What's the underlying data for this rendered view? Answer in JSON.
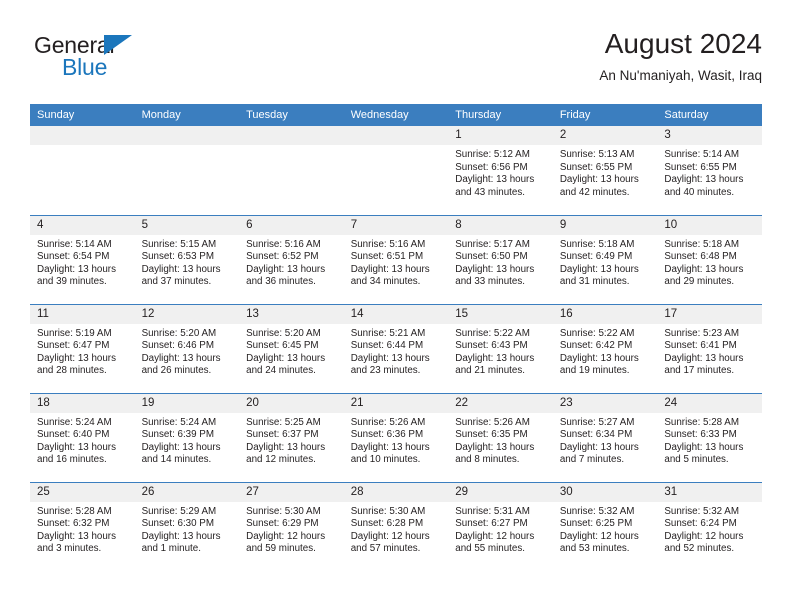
{
  "logo": {
    "word_top": "General",
    "word_bottom": "Blue",
    "accent_color": "#1b76bc"
  },
  "header": {
    "title": "August 2024",
    "subtitle": "An Nu'maniyah, Wasit, Iraq"
  },
  "theme": {
    "header_blue": "#3b7ebf",
    "daynum_band": "#f0f0f0",
    "text": "#231f20"
  },
  "weekday_headers": [
    "Sunday",
    "Monday",
    "Tuesday",
    "Wednesday",
    "Thursday",
    "Friday",
    "Saturday"
  ],
  "weeks": [
    [
      {
        "day": "",
        "sunrise": "",
        "sunset": "",
        "daylight1": "",
        "daylight2": "",
        "empty": true
      },
      {
        "day": "",
        "sunrise": "",
        "sunset": "",
        "daylight1": "",
        "daylight2": "",
        "empty": true
      },
      {
        "day": "",
        "sunrise": "",
        "sunset": "",
        "daylight1": "",
        "daylight2": "",
        "empty": true
      },
      {
        "day": "",
        "sunrise": "",
        "sunset": "",
        "daylight1": "",
        "daylight2": "",
        "empty": true
      },
      {
        "day": "1",
        "sunrise": "Sunrise: 5:12 AM",
        "sunset": "Sunset: 6:56 PM",
        "daylight1": "Daylight: 13 hours",
        "daylight2": "and 43 minutes."
      },
      {
        "day": "2",
        "sunrise": "Sunrise: 5:13 AM",
        "sunset": "Sunset: 6:55 PM",
        "daylight1": "Daylight: 13 hours",
        "daylight2": "and 42 minutes."
      },
      {
        "day": "3",
        "sunrise": "Sunrise: 5:14 AM",
        "sunset": "Sunset: 6:55 PM",
        "daylight1": "Daylight: 13 hours",
        "daylight2": "and 40 minutes."
      }
    ],
    [
      {
        "day": "4",
        "sunrise": "Sunrise: 5:14 AM",
        "sunset": "Sunset: 6:54 PM",
        "daylight1": "Daylight: 13 hours",
        "daylight2": "and 39 minutes."
      },
      {
        "day": "5",
        "sunrise": "Sunrise: 5:15 AM",
        "sunset": "Sunset: 6:53 PM",
        "daylight1": "Daylight: 13 hours",
        "daylight2": "and 37 minutes."
      },
      {
        "day": "6",
        "sunrise": "Sunrise: 5:16 AM",
        "sunset": "Sunset: 6:52 PM",
        "daylight1": "Daylight: 13 hours",
        "daylight2": "and 36 minutes."
      },
      {
        "day": "7",
        "sunrise": "Sunrise: 5:16 AM",
        "sunset": "Sunset: 6:51 PM",
        "daylight1": "Daylight: 13 hours",
        "daylight2": "and 34 minutes."
      },
      {
        "day": "8",
        "sunrise": "Sunrise: 5:17 AM",
        "sunset": "Sunset: 6:50 PM",
        "daylight1": "Daylight: 13 hours",
        "daylight2": "and 33 minutes."
      },
      {
        "day": "9",
        "sunrise": "Sunrise: 5:18 AM",
        "sunset": "Sunset: 6:49 PM",
        "daylight1": "Daylight: 13 hours",
        "daylight2": "and 31 minutes."
      },
      {
        "day": "10",
        "sunrise": "Sunrise: 5:18 AM",
        "sunset": "Sunset: 6:48 PM",
        "daylight1": "Daylight: 13 hours",
        "daylight2": "and 29 minutes."
      }
    ],
    [
      {
        "day": "11",
        "sunrise": "Sunrise: 5:19 AM",
        "sunset": "Sunset: 6:47 PM",
        "daylight1": "Daylight: 13 hours",
        "daylight2": "and 28 minutes."
      },
      {
        "day": "12",
        "sunrise": "Sunrise: 5:20 AM",
        "sunset": "Sunset: 6:46 PM",
        "daylight1": "Daylight: 13 hours",
        "daylight2": "and 26 minutes."
      },
      {
        "day": "13",
        "sunrise": "Sunrise: 5:20 AM",
        "sunset": "Sunset: 6:45 PM",
        "daylight1": "Daylight: 13 hours",
        "daylight2": "and 24 minutes."
      },
      {
        "day": "14",
        "sunrise": "Sunrise: 5:21 AM",
        "sunset": "Sunset: 6:44 PM",
        "daylight1": "Daylight: 13 hours",
        "daylight2": "and 23 minutes."
      },
      {
        "day": "15",
        "sunrise": "Sunrise: 5:22 AM",
        "sunset": "Sunset: 6:43 PM",
        "daylight1": "Daylight: 13 hours",
        "daylight2": "and 21 minutes."
      },
      {
        "day": "16",
        "sunrise": "Sunrise: 5:22 AM",
        "sunset": "Sunset: 6:42 PM",
        "daylight1": "Daylight: 13 hours",
        "daylight2": "and 19 minutes."
      },
      {
        "day": "17",
        "sunrise": "Sunrise: 5:23 AM",
        "sunset": "Sunset: 6:41 PM",
        "daylight1": "Daylight: 13 hours",
        "daylight2": "and 17 minutes."
      }
    ],
    [
      {
        "day": "18",
        "sunrise": "Sunrise: 5:24 AM",
        "sunset": "Sunset: 6:40 PM",
        "daylight1": "Daylight: 13 hours",
        "daylight2": "and 16 minutes."
      },
      {
        "day": "19",
        "sunrise": "Sunrise: 5:24 AM",
        "sunset": "Sunset: 6:39 PM",
        "daylight1": "Daylight: 13 hours",
        "daylight2": "and 14 minutes."
      },
      {
        "day": "20",
        "sunrise": "Sunrise: 5:25 AM",
        "sunset": "Sunset: 6:37 PM",
        "daylight1": "Daylight: 13 hours",
        "daylight2": "and 12 minutes."
      },
      {
        "day": "21",
        "sunrise": "Sunrise: 5:26 AM",
        "sunset": "Sunset: 6:36 PM",
        "daylight1": "Daylight: 13 hours",
        "daylight2": "and 10 minutes."
      },
      {
        "day": "22",
        "sunrise": "Sunrise: 5:26 AM",
        "sunset": "Sunset: 6:35 PM",
        "daylight1": "Daylight: 13 hours",
        "daylight2": "and 8 minutes."
      },
      {
        "day": "23",
        "sunrise": "Sunrise: 5:27 AM",
        "sunset": "Sunset: 6:34 PM",
        "daylight1": "Daylight: 13 hours",
        "daylight2": "and 7 minutes."
      },
      {
        "day": "24",
        "sunrise": "Sunrise: 5:28 AM",
        "sunset": "Sunset: 6:33 PM",
        "daylight1": "Daylight: 13 hours",
        "daylight2": "and 5 minutes."
      }
    ],
    [
      {
        "day": "25",
        "sunrise": "Sunrise: 5:28 AM",
        "sunset": "Sunset: 6:32 PM",
        "daylight1": "Daylight: 13 hours",
        "daylight2": "and 3 minutes."
      },
      {
        "day": "26",
        "sunrise": "Sunrise: 5:29 AM",
        "sunset": "Sunset: 6:30 PM",
        "daylight1": "Daylight: 13 hours",
        "daylight2": "and 1 minute."
      },
      {
        "day": "27",
        "sunrise": "Sunrise: 5:30 AM",
        "sunset": "Sunset: 6:29 PM",
        "daylight1": "Daylight: 12 hours",
        "daylight2": "and 59 minutes."
      },
      {
        "day": "28",
        "sunrise": "Sunrise: 5:30 AM",
        "sunset": "Sunset: 6:28 PM",
        "daylight1": "Daylight: 12 hours",
        "daylight2": "and 57 minutes."
      },
      {
        "day": "29",
        "sunrise": "Sunrise: 5:31 AM",
        "sunset": "Sunset: 6:27 PM",
        "daylight1": "Daylight: 12 hours",
        "daylight2": "and 55 minutes."
      },
      {
        "day": "30",
        "sunrise": "Sunrise: 5:32 AM",
        "sunset": "Sunset: 6:25 PM",
        "daylight1": "Daylight: 12 hours",
        "daylight2": "and 53 minutes."
      },
      {
        "day": "31",
        "sunrise": "Sunrise: 5:32 AM",
        "sunset": "Sunset: 6:24 PM",
        "daylight1": "Daylight: 12 hours",
        "daylight2": "and 52 minutes."
      }
    ]
  ]
}
